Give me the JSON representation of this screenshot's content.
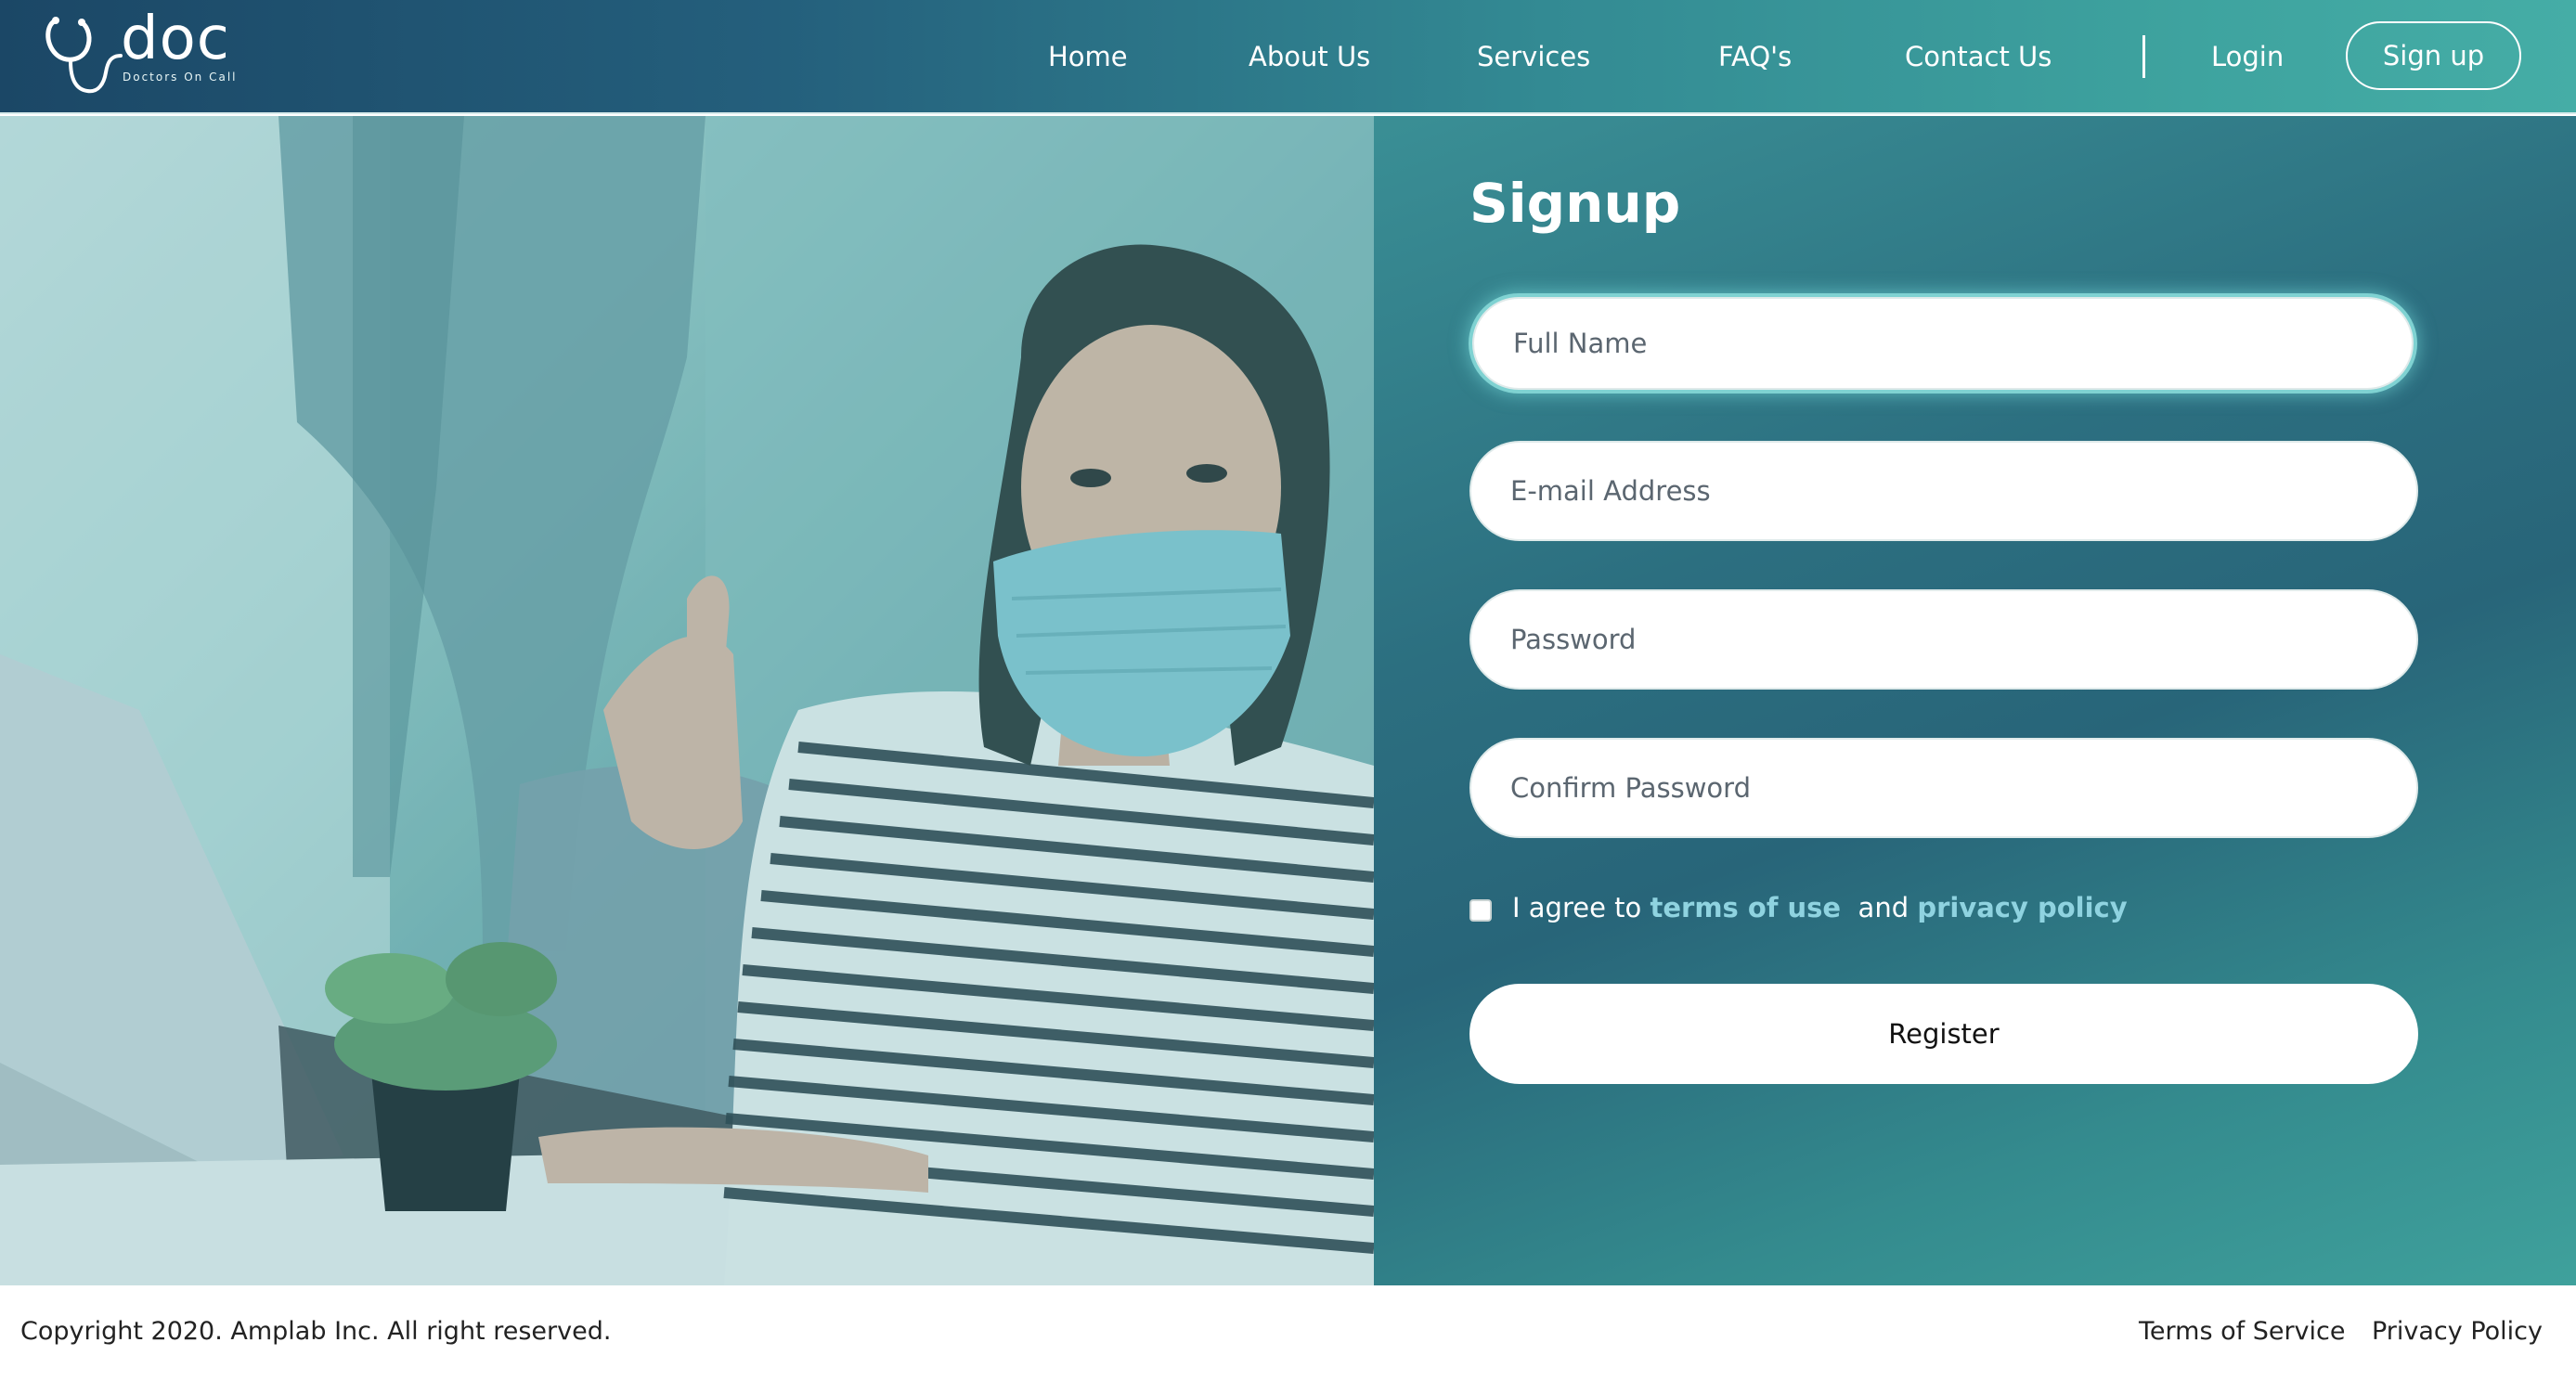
{
  "header": {
    "logo": {
      "word": "doc",
      "tagline": "Doctors On Call",
      "icon": "stethoscope-icon"
    },
    "nav": [
      {
        "label": "Home"
      },
      {
        "label": "About Us"
      },
      {
        "label": "Services"
      },
      {
        "label": "FAQ's"
      },
      {
        "label": "Contact Us"
      }
    ],
    "login_label": "Login",
    "signup_label": "Sign up"
  },
  "signup": {
    "title": "Signup",
    "fields": [
      {
        "placeholder": "Full Name",
        "value": ""
      },
      {
        "placeholder": "E-mail Address",
        "value": ""
      },
      {
        "placeholder": "Password",
        "value": ""
      },
      {
        "placeholder": "Confirm Password",
        "value": ""
      }
    ],
    "agree": {
      "prefix": "I agree to ",
      "terms_link": "terms of use",
      "middle": "  and ",
      "privacy_link": "privacy policy",
      "checked": false
    },
    "register_label": "Register"
  },
  "footer": {
    "copyright": "Copyright 2020. Amplab Inc. All right reserved.",
    "terms_label": "Terms of Service",
    "privacy_label": "Privacy Policy"
  },
  "colors": {
    "header_start": "#1b4766",
    "header_end": "#45ada6",
    "panel_teal": "#2c6f80",
    "link_accent": "#8fd3e0"
  }
}
